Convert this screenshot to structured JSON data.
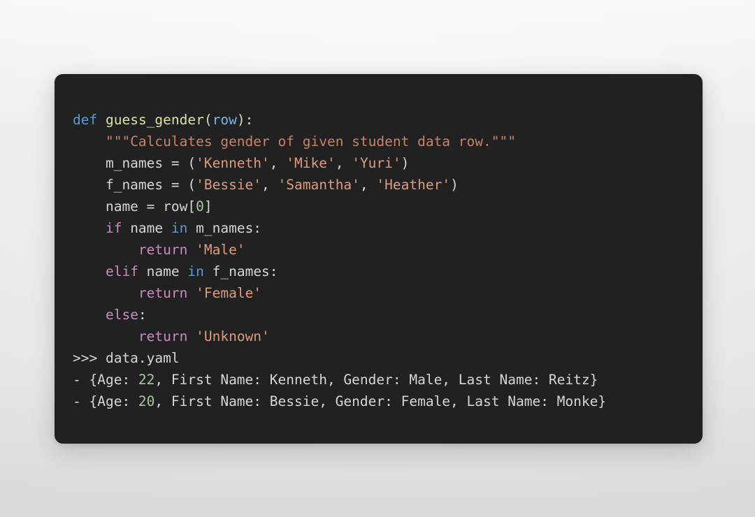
{
  "card": {
    "background_color": "#212121",
    "page_background_color": "#efefef"
  },
  "palette": {
    "keyword": "#c98bc0",
    "def_keyword": "#5a9ad4",
    "function_name": "#dfe0a8",
    "parameter": "#78b8e8",
    "string": "#de9b7e",
    "docstring": "#c98268",
    "number": "#a8c9a0",
    "plain": "#d6d6d6"
  },
  "code": {
    "language": "python",
    "lines": [
      {
        "n": 1,
        "text": "def guess_gender(row):",
        "tokens": [
          {
            "t": "def",
            "c": "tok-def"
          },
          {
            "t": " ",
            "c": "tok-plain"
          },
          {
            "t": "guess_gender",
            "c": "tok-fn"
          },
          {
            "t": "(",
            "c": "tok-punct"
          },
          {
            "t": "row",
            "c": "tok-param"
          },
          {
            "t": "):",
            "c": "tok-punct"
          }
        ]
      },
      {
        "n": 2,
        "text": "    \"\"\"Calculates gender of given student data row.\"\"\"",
        "tokens": [
          {
            "t": "    ",
            "c": "tok-plain"
          },
          {
            "t": "\"\"\"Calculates gender of given student data row.\"\"\"",
            "c": "tok-doc"
          }
        ]
      },
      {
        "n": 3,
        "text": "    m_names = ('Kenneth', 'Mike', 'Yuri')",
        "tokens": [
          {
            "t": "    m_names = (",
            "c": "tok-plain"
          },
          {
            "t": "'Kenneth'",
            "c": "tok-str"
          },
          {
            "t": ", ",
            "c": "tok-plain"
          },
          {
            "t": "'Mike'",
            "c": "tok-str"
          },
          {
            "t": ", ",
            "c": "tok-plain"
          },
          {
            "t": "'Yuri'",
            "c": "tok-str"
          },
          {
            "t": ")",
            "c": "tok-plain"
          }
        ]
      },
      {
        "n": 4,
        "text": "    f_names = ('Bessie', 'Samantha', 'Heather')",
        "tokens": [
          {
            "t": "    f_names = (",
            "c": "tok-plain"
          },
          {
            "t": "'Bessie'",
            "c": "tok-str"
          },
          {
            "t": ", ",
            "c": "tok-plain"
          },
          {
            "t": "'Samantha'",
            "c": "tok-str"
          },
          {
            "t": ", ",
            "c": "tok-plain"
          },
          {
            "t": "'Heather'",
            "c": "tok-str"
          },
          {
            "t": ")",
            "c": "tok-plain"
          }
        ]
      },
      {
        "n": 5,
        "text": "    name = row[0]",
        "tokens": [
          {
            "t": "    name = row[",
            "c": "tok-plain"
          },
          {
            "t": "0",
            "c": "tok-num"
          },
          {
            "t": "]",
            "c": "tok-plain"
          }
        ]
      },
      {
        "n": 6,
        "text": "    if name in m_names:",
        "tokens": [
          {
            "t": "    ",
            "c": "tok-plain"
          },
          {
            "t": "if",
            "c": "tok-kw"
          },
          {
            "t": " name ",
            "c": "tok-plain"
          },
          {
            "t": "in",
            "c": "tok-def"
          },
          {
            "t": " m_names:",
            "c": "tok-plain"
          }
        ]
      },
      {
        "n": 7,
        "text": "        return 'Male'",
        "tokens": [
          {
            "t": "        ",
            "c": "tok-plain"
          },
          {
            "t": "return",
            "c": "tok-kw"
          },
          {
            "t": " ",
            "c": "tok-plain"
          },
          {
            "t": "'Male'",
            "c": "tok-str"
          }
        ]
      },
      {
        "n": 8,
        "text": "    elif name in f_names:",
        "tokens": [
          {
            "t": "    ",
            "c": "tok-plain"
          },
          {
            "t": "elif",
            "c": "tok-kw"
          },
          {
            "t": " name ",
            "c": "tok-plain"
          },
          {
            "t": "in",
            "c": "tok-def"
          },
          {
            "t": " f_names:",
            "c": "tok-plain"
          }
        ]
      },
      {
        "n": 9,
        "text": "        return 'Female'",
        "tokens": [
          {
            "t": "        ",
            "c": "tok-plain"
          },
          {
            "t": "return",
            "c": "tok-kw"
          },
          {
            "t": " ",
            "c": "tok-plain"
          },
          {
            "t": "'Female'",
            "c": "tok-str"
          }
        ]
      },
      {
        "n": 10,
        "text": "    else:",
        "tokens": [
          {
            "t": "    ",
            "c": "tok-plain"
          },
          {
            "t": "else",
            "c": "tok-kw"
          },
          {
            "t": ":",
            "c": "tok-plain"
          }
        ]
      },
      {
        "n": 11,
        "text": "        return 'Unknown'",
        "tokens": [
          {
            "t": "        ",
            "c": "tok-plain"
          },
          {
            "t": "return",
            "c": "tok-kw"
          },
          {
            "t": " ",
            "c": "tok-plain"
          },
          {
            "t": "'Unknown'",
            "c": "tok-str"
          }
        ]
      },
      {
        "n": 12,
        "text": ">>> data.yaml",
        "tokens": [
          {
            "t": ">>> data.yaml",
            "c": "tok-plain"
          }
        ]
      },
      {
        "n": 13,
        "text": "- {Age: 22, First Name: Kenneth, Gender: Male, Last Name: Reitz}",
        "tokens": [
          {
            "t": "- {Age: ",
            "c": "tok-plain"
          },
          {
            "t": "22",
            "c": "tok-num"
          },
          {
            "t": ", First Name: Kenneth, Gender: Male, Last Name: Reitz}",
            "c": "tok-plain"
          }
        ]
      },
      {
        "n": 14,
        "text": "- {Age: 20, First Name: Bessie, Gender: Female, Last Name: Monke}",
        "tokens": [
          {
            "t": "- {Age: ",
            "c": "tok-plain"
          },
          {
            "t": "20",
            "c": "tok-num"
          },
          {
            "t": ", First Name: Bessie, Gender: Female, Last Name: Monke}",
            "c": "tok-plain"
          }
        ]
      }
    ]
  }
}
